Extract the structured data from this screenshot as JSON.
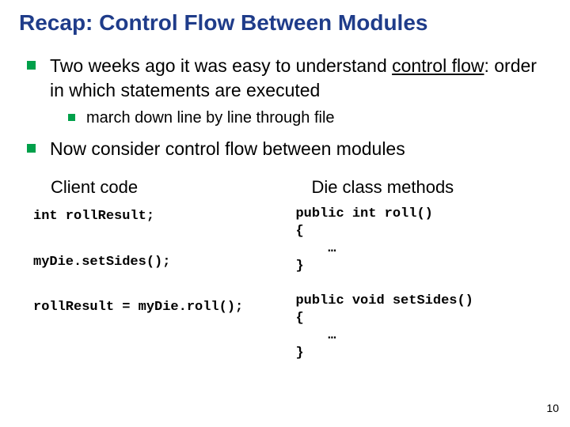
{
  "title": "Recap: Control Flow Between Modules",
  "bullets": {
    "b1_prefix": "Two weeks ago it was easy to understand ",
    "b1_underlined": "control flow",
    "b1_suffix": ": order in which statements are executed",
    "b1a": "march down line by line through file",
    "b2": "Now consider control flow between modules"
  },
  "left": {
    "heading": "Client code",
    "code": "int rollResult;\n\nmyDie.setSides();\n\nrollResult = myDie.roll();"
  },
  "right": {
    "heading": "Die class methods",
    "code": "public int roll()\n{\n    …\n}\n\npublic void setSides()\n{\n    …\n}"
  },
  "pagenum": "10"
}
